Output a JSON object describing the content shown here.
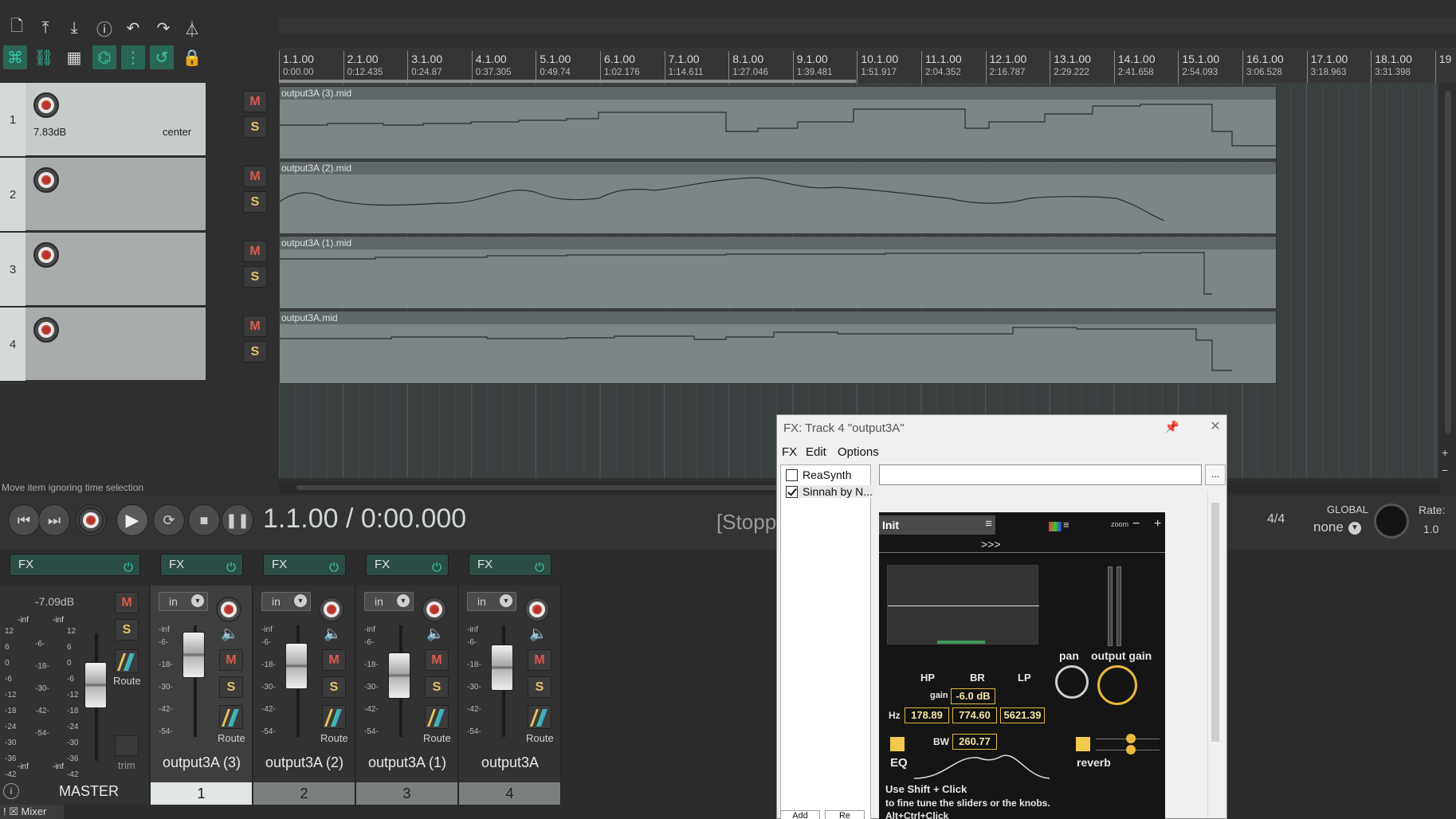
{
  "toolbar": {
    "row1_icons": [
      "new-file-icon",
      "save-project-icon",
      "render-icon",
      "info-icon",
      "undo-icon",
      "redo-icon",
      "metronome-icon"
    ],
    "row2_icons": [
      "ripple-edit-icon",
      "link-icon",
      "grid-icon",
      "auto-crossfade-icon",
      "snap-grid-icon",
      "loop-icon",
      "lock-icon"
    ]
  },
  "ruler": {
    "markers": [
      {
        "m": "1.1.00",
        "t": "0:00.00"
      },
      {
        "m": "2.1.00",
        "t": "0:12.435"
      },
      {
        "m": "3.1.00",
        "t": "0:24.87"
      },
      {
        "m": "4.1.00",
        "t": "0:37.305"
      },
      {
        "m": "5.1.00",
        "t": "0:49.74"
      },
      {
        "m": "6.1.00",
        "t": "1:02.176"
      },
      {
        "m": "7.1.00",
        "t": "1:14.611"
      },
      {
        "m": "8.1.00",
        "t": "1:27.046"
      },
      {
        "m": "9.1.00",
        "t": "1:39.481"
      },
      {
        "m": "10.1.00",
        "t": "1:51.917"
      },
      {
        "m": "11.1.00",
        "t": "2:04.352"
      },
      {
        "m": "12.1.00",
        "t": "2:16.787"
      },
      {
        "m": "13.1.00",
        "t": "2:29.222"
      },
      {
        "m": "14.1.00",
        "t": "2:41.658"
      },
      {
        "m": "15.1.00",
        "t": "2:54.093"
      },
      {
        "m": "16.1.00",
        "t": "3:06.528"
      },
      {
        "m": "17.1.00",
        "t": "3:18.963"
      },
      {
        "m": "18.1.00",
        "t": "3:31.398"
      },
      {
        "m": "19",
        "t": ""
      }
    ]
  },
  "tracks": [
    {
      "num": "1",
      "volume": "7.83dB",
      "pan": "center",
      "item": "output3A (3).mid",
      "m": "M",
      "s": "S"
    },
    {
      "num": "2",
      "volume": "",
      "pan": "",
      "item": "output3A (2).mid",
      "m": "M",
      "s": "S"
    },
    {
      "num": "3",
      "volume": "",
      "pan": "",
      "item": "output3A (1).mid",
      "m": "M",
      "s": "S"
    },
    {
      "num": "4",
      "volume": "",
      "pan": "",
      "item": "output3A.mid",
      "m": "M",
      "s": "S"
    }
  ],
  "status": {
    "hint": "Move item ignoring time selection"
  },
  "transport": {
    "position": "1.1.00 / 0:00.000",
    "state": "[Stoppe",
    "time_sig": "4/4",
    "global_label": "GLOBAL",
    "global_value": "none",
    "rate_label": "Rate:",
    "rate_value": "1.0"
  },
  "mixer": {
    "master": {
      "fx": "FX",
      "volume": "-7.09dB",
      "m": "M",
      "s": "S",
      "route": "Route",
      "trim": "trim",
      "name": "MASTER",
      "inf_left": "-inf",
      "inf_right": "-inf",
      "scale_left": [
        "12",
        "6",
        "0",
        "-6",
        "-12",
        "-18",
        "-24",
        "-30",
        "-36",
        "-42"
      ],
      "scale_mid": [
        "-6-",
        "-18-",
        "-30-",
        "-42-",
        "-54-"
      ],
      "scale_right": [
        "12",
        "6",
        "0",
        "-6",
        "-12",
        "-18",
        "-24",
        "-30",
        "-36",
        "-42"
      ]
    },
    "strips": [
      {
        "fx": "FX",
        "in": "in",
        "m": "M",
        "s": "S",
        "route": "Route",
        "name": "output3A (3)",
        "num": "1",
        "inf": "-inf",
        "scale": [
          "-6-",
          "-18-",
          "-30-",
          "-42-",
          "-54-"
        ]
      },
      {
        "fx": "FX",
        "in": "in",
        "m": "M",
        "s": "S",
        "route": "Route",
        "name": "output3A (2)",
        "num": "2",
        "inf": "-inf",
        "scale": [
          "-6-",
          "-18-",
          "-30-",
          "-42-",
          "-54-"
        ]
      },
      {
        "fx": "FX",
        "in": "in",
        "m": "M",
        "s": "S",
        "route": "Route",
        "name": "output3A (1)",
        "num": "3",
        "inf": "-inf",
        "scale": [
          "-6-",
          "-18-",
          "-30-",
          "-42-",
          "-54-"
        ]
      },
      {
        "fx": "FX",
        "in": "in",
        "m": "M",
        "s": "S",
        "route": "Route",
        "name": "output3A",
        "num": "4",
        "inf": "-inf",
        "scale": [
          "-6-",
          "-18-",
          "-30-",
          "-42-",
          "-54-"
        ]
      }
    ],
    "tab": "Mixer"
  },
  "fx_window": {
    "title": "FX: Track 4 \"output3A\"",
    "menu": [
      "FX",
      "Edit",
      "Options"
    ],
    "chain": [
      {
        "name": "ReaSynth",
        "enabled": false
      },
      {
        "name": "Sinnah by N...",
        "enabled": true
      }
    ],
    "preset_value": "",
    "dots": "...",
    "add_label": "Add",
    "remove_label": "Re",
    "plugin": {
      "preset": "Init",
      "arrows": ">>>",
      "zoom": "zoom",
      "hp": "HP",
      "br": "BR",
      "lp": "LP",
      "gain_label": "gain",
      "gain_value": "-6.0 dB",
      "hz_label": "Hz",
      "hp_hz": "178.89",
      "br_hz": "774.60",
      "lp_hz": "5621.39",
      "bw_label": "BW",
      "bw_value": "260.77",
      "eq": "EQ",
      "pan": "pan",
      "output_gain": "output gain",
      "reverb": "reverb",
      "help1": "Use Shift + Click",
      "help2": "to fine tune the sliders or the knobs.",
      "help3": "Alt+Ctrl+Click"
    }
  }
}
